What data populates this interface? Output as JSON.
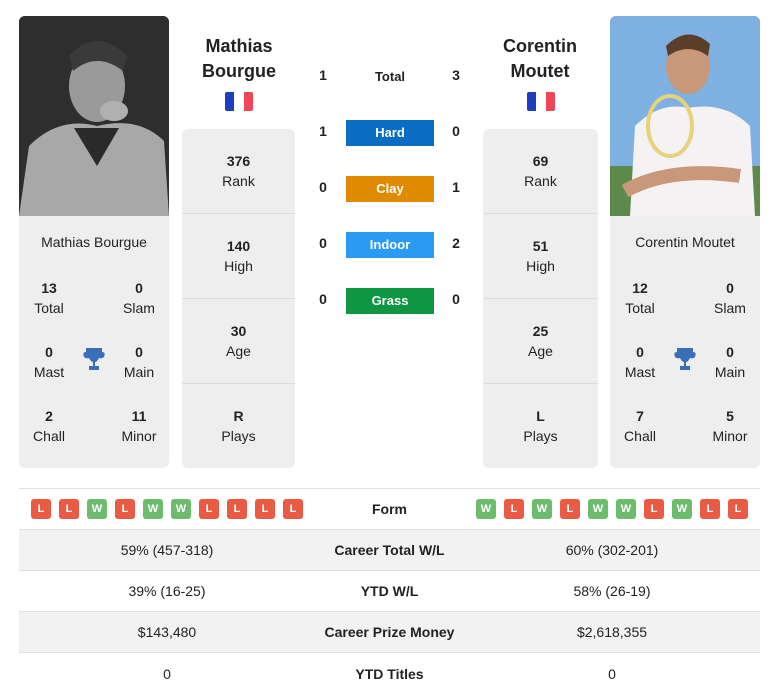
{
  "player1": {
    "name_line1": "Mathias",
    "name_line2": "Bourgue",
    "full_name": "Mathias Bourgue",
    "country": "France",
    "rank": "376",
    "rank_label": "Rank",
    "high": "140",
    "high_label": "High",
    "age": "30",
    "age_label": "Age",
    "plays": "R",
    "plays_label": "Plays",
    "titles": {
      "total": "13",
      "total_label": "Total",
      "slam": "0",
      "slam_label": "Slam",
      "mast": "0",
      "mast_label": "Mast",
      "main": "0",
      "main_label": "Main",
      "chall": "2",
      "chall_label": "Chall",
      "minor": "11",
      "minor_label": "Minor"
    },
    "form": [
      "L",
      "L",
      "W",
      "L",
      "W",
      "W",
      "L",
      "L",
      "L",
      "L"
    ],
    "career_wl": "59% (457-318)",
    "ytd_wl": "39% (16-25)",
    "prize_money": "$143,480",
    "ytd_titles": "0"
  },
  "player2": {
    "name_line1": "Corentin",
    "name_line2": "Moutet",
    "full_name": "Corentin Moutet",
    "country": "France",
    "rank": "69",
    "rank_label": "Rank",
    "high": "51",
    "high_label": "High",
    "age": "25",
    "age_label": "Age",
    "plays": "L",
    "plays_label": "Plays",
    "titles": {
      "total": "12",
      "total_label": "Total",
      "slam": "0",
      "slam_label": "Slam",
      "mast": "0",
      "mast_label": "Mast",
      "main": "0",
      "main_label": "Main",
      "chall": "7",
      "chall_label": "Chall",
      "minor": "5",
      "minor_label": "Minor"
    },
    "form": [
      "W",
      "L",
      "W",
      "L",
      "W",
      "W",
      "L",
      "W",
      "L",
      "L"
    ],
    "career_wl": "60% (302-201)",
    "ytd_wl": "58% (26-19)",
    "prize_money": "$2,618,355",
    "ytd_titles": "0"
  },
  "h2h": {
    "total": {
      "label": "Total",
      "p1": "1",
      "p2": "3"
    },
    "surfaces": [
      {
        "label": "Hard",
        "p1": "1",
        "p2": "0",
        "color": "#0a6dc2"
      },
      {
        "label": "Clay",
        "p1": "0",
        "p2": "1",
        "color": "#e08a00"
      },
      {
        "label": "Indoor",
        "p1": "0",
        "p2": "2",
        "color": "#2b9af3"
      },
      {
        "label": "Grass",
        "p1": "0",
        "p2": "0",
        "color": "#0e9642"
      }
    ]
  },
  "table": {
    "form_label": "Form",
    "career_wl_label": "Career Total W/L",
    "ytd_wl_label": "YTD W/L",
    "prize_label": "Career Prize Money",
    "ytd_titles_label": "YTD Titles"
  },
  "colors": {
    "win": "#6dbb6d",
    "loss": "#ea5b44",
    "flag_blue": "#1d3fbf",
    "flag_red": "#ef4756",
    "trophy": "#3a6fb8"
  },
  "icons": {
    "trophy": "trophy-icon",
    "flag": "france-flag-icon"
  }
}
